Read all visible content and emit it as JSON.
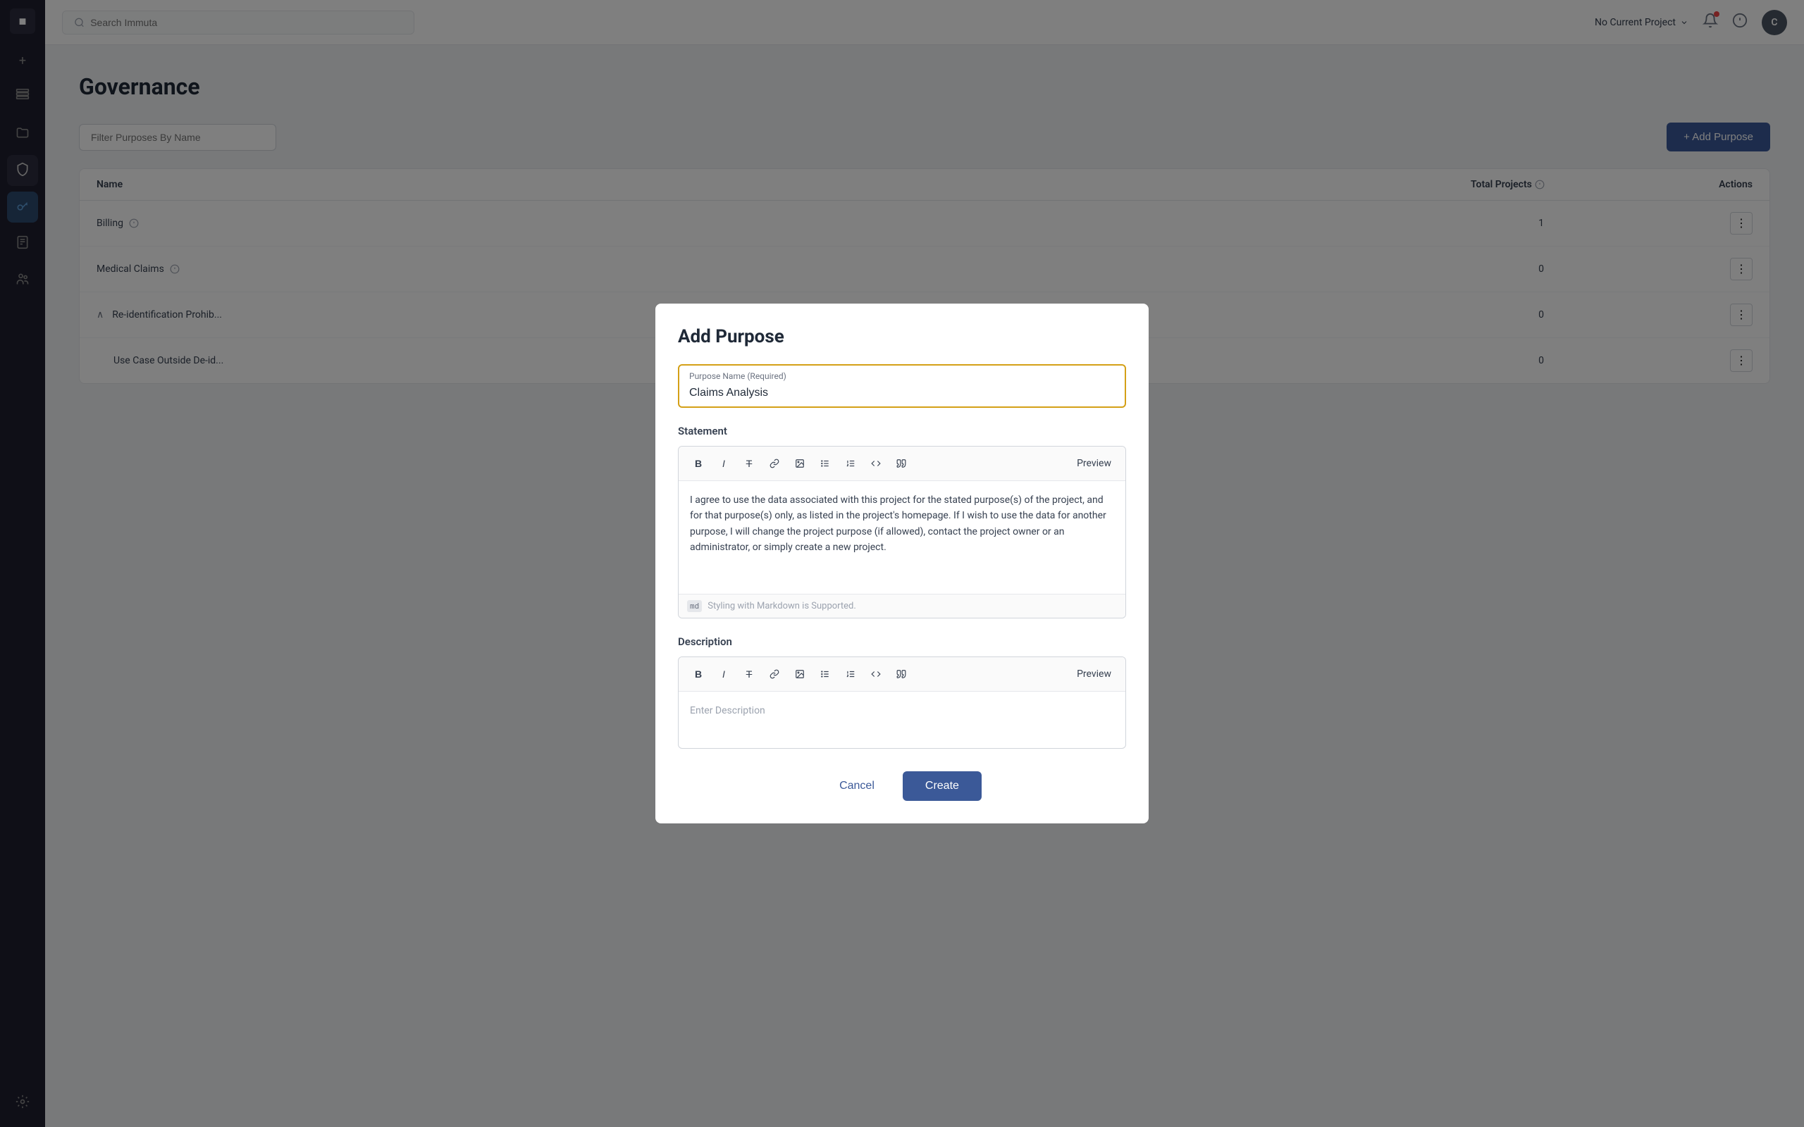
{
  "app": {
    "logo": "■",
    "title": "Immuta"
  },
  "topbar": {
    "search_placeholder": "Search Immuta",
    "project_label": "No Current Project",
    "user_initial": "C"
  },
  "sidebar": {
    "items": [
      {
        "id": "logo",
        "icon": "■",
        "label": "home"
      },
      {
        "id": "plus",
        "icon": "+",
        "label": "add"
      },
      {
        "id": "layers",
        "icon": "⊞",
        "label": "data-sources"
      },
      {
        "id": "folder",
        "icon": "▤",
        "label": "projects"
      },
      {
        "id": "shield",
        "icon": "🛡",
        "label": "governance"
      },
      {
        "id": "key",
        "icon": "🔑",
        "label": "purposes"
      },
      {
        "id": "doc",
        "icon": "📋",
        "label": "audit"
      },
      {
        "id": "users",
        "icon": "👥",
        "label": "users"
      },
      {
        "id": "gear",
        "icon": "⚙",
        "label": "settings"
      },
      {
        "id": "cog",
        "icon": "⚙",
        "label": "admin"
      }
    ]
  },
  "page": {
    "title": "Governance",
    "filter_placeholder": "Filter Purposes By Name",
    "add_purpose_label": "+ Add Purpose"
  },
  "table": {
    "columns": [
      "Name",
      "Total Projects",
      "Actions"
    ],
    "rows": [
      {
        "name": "Billing",
        "has_info": true,
        "total_projects": "1",
        "expanded": false
      },
      {
        "name": "Medical Claims",
        "has_info": true,
        "total_projects": "0",
        "expanded": false
      },
      {
        "name": "Re-identification Prohib...",
        "has_info": false,
        "total_projects": "0",
        "expanded": true,
        "is_sub": false
      },
      {
        "name": "Use Case Outside De-id...",
        "has_info": false,
        "total_projects": "0",
        "expanded": false
      }
    ]
  },
  "modal": {
    "title": "Add Purpose",
    "purpose_name_label": "Purpose Name (Required)",
    "purpose_name_value": "Claims Analysis",
    "statement_label": "Statement",
    "statement_text": "I agree to use the data associated with this project for the stated purpose(s) of the project, and for that purpose(s) only, as listed in the project's homepage. If I wish to use the data for another purpose, I will change the project purpose (if allowed), contact the project owner or an administrator, or simply create a new project.",
    "markdown_hint": "Styling with Markdown is Supported.",
    "description_label": "Description",
    "description_placeholder": "Enter Description",
    "preview_label": "Preview",
    "cancel_label": "Cancel",
    "create_label": "Create",
    "toolbar": {
      "bold": "B",
      "italic": "I",
      "strikethrough": "T",
      "link": "🔗",
      "image": "🖼",
      "bullet": "•",
      "numbered": "1.",
      "code": "</>",
      "quote": "\""
    }
  }
}
